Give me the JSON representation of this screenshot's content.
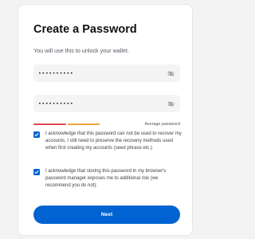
{
  "header": {
    "title": "Create a Password",
    "subtitle": "You will use this to unlock your wallet."
  },
  "fields": [
    {
      "value": "••••••••••",
      "icon": "eye-off-icon"
    },
    {
      "value": "••••••••••",
      "icon": "eye-off-icon"
    }
  ],
  "strength": {
    "label": "Average password",
    "level": 0.45
  },
  "checkboxes": [
    {
      "checked": true,
      "text": "I acknowledge that this password can not be used to recover my accounts, I still need to preserve the recovery methods used when first creating my accounts (seed phrase etc.)"
    },
    {
      "checked": true,
      "text": "I acknowledge that storing this password in my browser's password manager exposes me to additional risk (we recommend you do not)."
    }
  ],
  "next_label": "Next",
  "colors": {
    "accent": "#0063d1",
    "strength_red": "#e0484e",
    "strength_orange": "#f0a53a",
    "icon_grey": "#8a8d96"
  }
}
